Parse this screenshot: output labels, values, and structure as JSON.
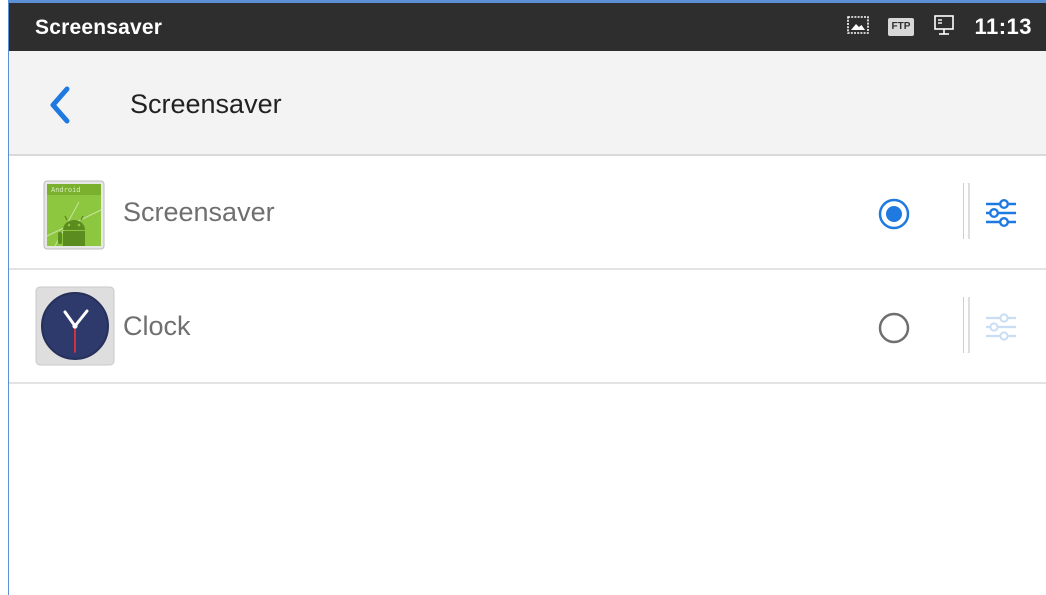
{
  "status_bar": {
    "title": "Screensaver",
    "time": "11:13",
    "ftp_badge": "FTP",
    "icons": [
      "image-icon",
      "ftp-icon",
      "screen-cast-icon"
    ]
  },
  "action_bar": {
    "back_icon": "chevron-left-icon",
    "title": "Screensaver"
  },
  "items": [
    {
      "label": "Screensaver",
      "icon": "android-screensaver-icon",
      "icon_text": "Android",
      "selected": true,
      "settings_enabled": true
    },
    {
      "label": "Clock",
      "icon": "clock-app-icon",
      "selected": false,
      "settings_enabled": false
    }
  ],
  "colors": {
    "status_bar_bg": "#2e2e2e",
    "action_bar_bg": "#f3f3f3",
    "accent": "#1e7ae0",
    "label_text": "#6f6f6f"
  }
}
